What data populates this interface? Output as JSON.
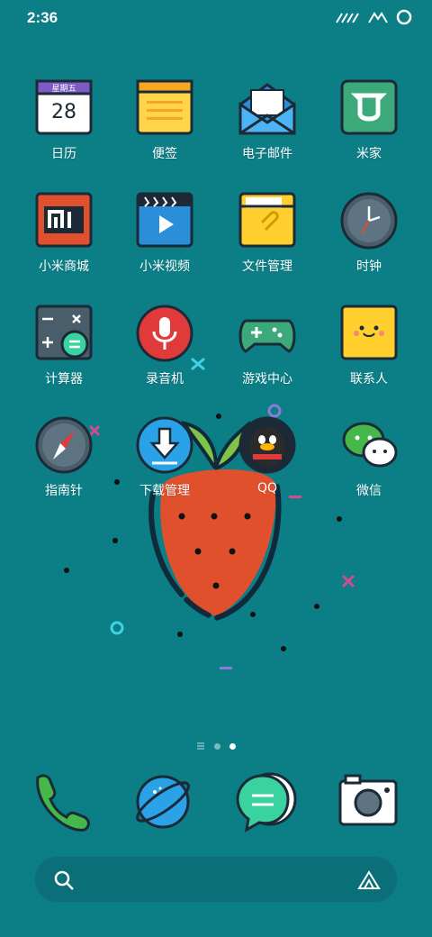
{
  "status_bar": {
    "time": "2:36"
  },
  "calendar_icon": {
    "weekday": "星期五",
    "day": "28"
  },
  "apps": [
    {
      "id": "calendar",
      "label": "日历"
    },
    {
      "id": "notes",
      "label": "便签"
    },
    {
      "id": "email",
      "label": "电子邮件"
    },
    {
      "id": "mijia",
      "label": "米家"
    },
    {
      "id": "mi-store",
      "label": "小米商城"
    },
    {
      "id": "mi-video",
      "label": "小米视频"
    },
    {
      "id": "file-manager",
      "label": "文件管理"
    },
    {
      "id": "clock",
      "label": "时钟"
    },
    {
      "id": "calculator",
      "label": "计算器"
    },
    {
      "id": "recorder",
      "label": "录音机"
    },
    {
      "id": "game-center",
      "label": "游戏中心"
    },
    {
      "id": "contacts",
      "label": "联系人"
    },
    {
      "id": "compass",
      "label": "指南针"
    },
    {
      "id": "downloads",
      "label": "下载管理"
    },
    {
      "id": "qq",
      "label": "QQ"
    },
    {
      "id": "wechat",
      "label": "微信"
    }
  ],
  "page_indicator": {
    "pages": 2,
    "current": 2
  },
  "dock": [
    "phone",
    "browser",
    "messages",
    "camera"
  ],
  "colors": {
    "background": "#0b7e86",
    "accent": "#ffffff"
  }
}
